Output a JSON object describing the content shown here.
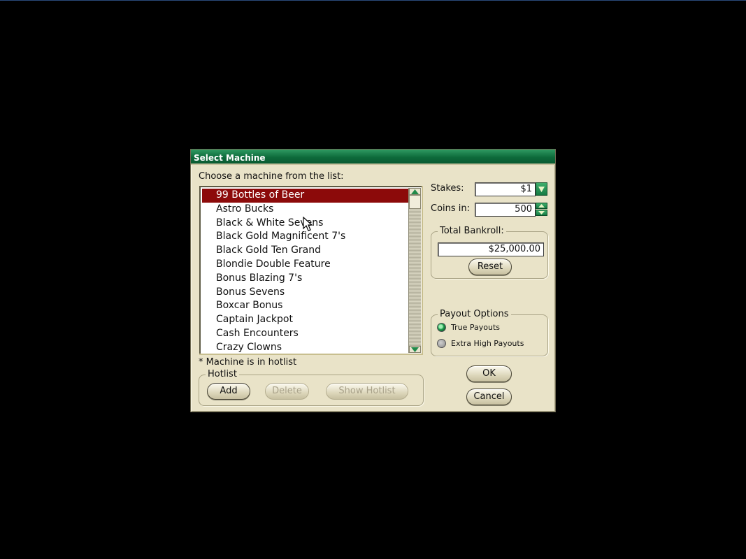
{
  "window": {
    "title": "Select Machine"
  },
  "list": {
    "prompt": "Choose a machine from the list:",
    "items": [
      "99 Bottles of Beer",
      "Astro Bucks",
      "Black & White Sevens",
      "Black Gold Magnificent 7's",
      "Black Gold Ten Grand",
      "Blondie Double Feature",
      "Bonus Blazing 7's",
      "Bonus Sevens",
      "Boxcar Bonus",
      "Captain Jackpot",
      "Cash Encounters",
      "Crazy Clowns"
    ],
    "selected_index": 0,
    "hotlist_note": "* Machine is in hotlist"
  },
  "hotlist": {
    "title": "Hotlist",
    "add_label": "Add",
    "delete_label": "Delete",
    "show_label": "Show Hotlist"
  },
  "stakes": {
    "label": "Stakes:",
    "value": "$1"
  },
  "coins": {
    "label": "Coins in:",
    "value": "500"
  },
  "bankroll": {
    "title": "Total Bankroll:",
    "value": "$25,000.00",
    "reset_label": "Reset"
  },
  "payout": {
    "title": "Payout Options",
    "options": [
      "True Payouts",
      "Extra High Payouts"
    ],
    "selected_index": 0
  },
  "actions": {
    "ok_label": "OK",
    "cancel_label": "Cancel"
  },
  "colors": {
    "titlebar": "#0d6b3b",
    "selection": "#8c0a0a",
    "dialog_bg": "#e9e3c8"
  }
}
